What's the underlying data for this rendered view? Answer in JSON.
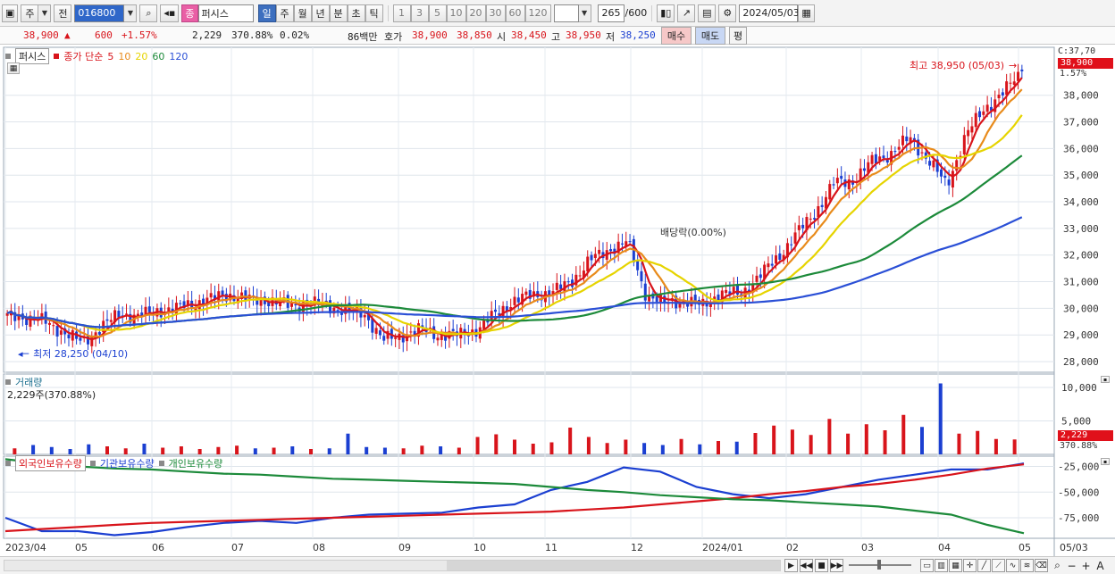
{
  "toolbar": {
    "period_type": "주",
    "prev_label": "전",
    "stock_code": "016800",
    "stock_name": "퍼시스",
    "tabs": [
      "일",
      "주",
      "월",
      "년",
      "분",
      "초",
      "틱"
    ],
    "active_tab": "일",
    "intervals": [
      "1",
      "3",
      "5",
      "10",
      "20",
      "30",
      "60",
      "120"
    ],
    "count": "265",
    "count_total": "/600",
    "date": "2024/05/03"
  },
  "quote": {
    "price": "38,900",
    "change": "600",
    "change_pct": "+1.57%",
    "volume": "2,229",
    "volume_ratio": "370.88%",
    "turnover": "0.02%",
    "amount": "86백만",
    "hoga_label": "호가",
    "ask": "38,900",
    "bid": "38,850",
    "open_label": "시",
    "open": "38,450",
    "high_label": "고",
    "high": "38,950",
    "low_label": "저",
    "low": "38,250",
    "buy_label": "매수",
    "sell_label": "매도",
    "eval_label": "평"
  },
  "legend": {
    "name": "퍼시스",
    "ma_title": "종가 단순",
    "ma_periods": [
      "5",
      "10",
      "20",
      "60",
      "120"
    ],
    "ma_colors": [
      "#d8141b",
      "#e88b1b",
      "#e6d400",
      "#1c8a3a",
      "#2a4fd6"
    ],
    "volume_title": "거래량",
    "volume_value": "2,229주(370.88%)",
    "holding_foreign": "외국인보유수량",
    "holding_inst": "기관보유수량",
    "holding_indiv": "개인보유수량"
  },
  "annotations": {
    "high_note": "최고 38,950 (05/03)",
    "low_note": "최저 28,250 (04/10)",
    "dividend_note": "배당락(0.00%)",
    "c_value": "C:37,70",
    "price_badge": "38,900",
    "pct_badge": "1.57%",
    "vol_badge": "2,229",
    "vol_pct_badge": "370.88%"
  },
  "colors": {
    "up": "#d8141b",
    "down": "#1b3fd1",
    "ma5": "#d8141b",
    "ma10": "#e88b1b",
    "ma20": "#e6d400",
    "ma60": "#1c8a3a",
    "ma120": "#2a4fd6",
    "foreign": "#1b3fd1",
    "inst": "#d8141b",
    "indiv": "#1c8a3a"
  },
  "chart_data": [
    {
      "type": "candlestick",
      "title": "퍼시스",
      "x": [
        "2023/04",
        "05",
        "06",
        "07",
        "08",
        "09",
        "10",
        "11",
        "12",
        "2024/01",
        "02",
        "03",
        "04",
        "05"
      ],
      "yticks": [
        28000,
        29000,
        30000,
        31000,
        32000,
        33000,
        34000,
        35000,
        36000,
        37000,
        38000
      ],
      "ylim": [
        27600,
        39800
      ],
      "close_path": [
        29700,
        29650,
        29500,
        29100,
        28700,
        29300,
        29800,
        29700,
        29900,
        30000,
        30200,
        30400,
        30500,
        30300,
        30300,
        30100,
        30200,
        30100,
        29900,
        29800,
        28800,
        29000,
        29200,
        29000,
        29000,
        29200,
        29800,
        30300,
        30500,
        30600,
        31000,
        31800,
        32200,
        32500,
        30500,
        30200,
        30300,
        30100,
        30600,
        30500,
        31200,
        31900,
        32800,
        33600,
        34700,
        34800,
        35500,
        35800,
        36400,
        35600,
        34600,
        36500,
        37500,
        38100,
        38900
      ]
    },
    {
      "type": "bar",
      "title": "거래량",
      "yticks": [
        5000,
        10000
      ],
      "ylim": [
        0,
        11200
      ],
      "values": [
        900,
        1400,
        1100,
        800,
        1500,
        1200,
        900,
        1600,
        1000,
        1200,
        800,
        1100,
        1300,
        900,
        1000,
        1200,
        800,
        900,
        3100,
        1100,
        1000,
        900,
        1300,
        1200,
        1000,
        2600,
        3000,
        2200,
        1600,
        1800,
        4000,
        2600,
        1700,
        2200,
        1700,
        1400,
        2300,
        1500,
        2000,
        1900,
        3200,
        4300,
        3700,
        2900,
        5300,
        3100,
        4500,
        3600,
        5900,
        4100,
        10600,
        3100,
        3500,
        2300,
        2229
      ]
    },
    {
      "type": "line",
      "title": "보유수량",
      "yticks": [
        -75000,
        -50000,
        -25000
      ],
      "ylim": [
        -95000,
        -15000
      ],
      "series": [
        {
          "name": "외국인보유수량",
          "values": [
            -75000,
            -88000,
            -88000,
            -92000,
            -89000,
            -84000,
            -80000,
            -78000,
            -80000,
            -75000,
            -72000,
            -71000,
            -70000,
            -65000,
            -62000,
            -48000,
            -40000,
            -26000,
            -30000,
            -45000,
            -52000,
            -56000,
            -52000,
            -45000,
            -38000,
            -33000,
            -28000,
            -28000,
            -22000
          ]
        },
        {
          "name": "기관보유수량",
          "values": [
            -88000,
            -86000,
            -84000,
            -82000,
            -80000,
            -79000,
            -78000,
            -77000,
            -76000,
            -75000,
            -74000,
            -73000,
            -72000,
            -71000,
            -70000,
            -69000,
            -67000,
            -65000,
            -62000,
            -59000,
            -56000,
            -52000,
            -49000,
            -45000,
            -42000,
            -38000,
            -33000,
            -27000,
            -23000
          ]
        },
        {
          "name": "개인보유수량",
          "values": [
            -18000,
            -22000,
            -25000,
            -27000,
            -28000,
            -30000,
            -32000,
            -33000,
            -35000,
            -37000,
            -38000,
            -39000,
            -40000,
            -41000,
            -42000,
            -45000,
            -48000,
            -50000,
            -53000,
            -55000,
            -57000,
            -58000,
            -60000,
            -62000,
            -64000,
            -68000,
            -72000,
            -82000,
            -90000
          ]
        }
      ]
    }
  ]
}
